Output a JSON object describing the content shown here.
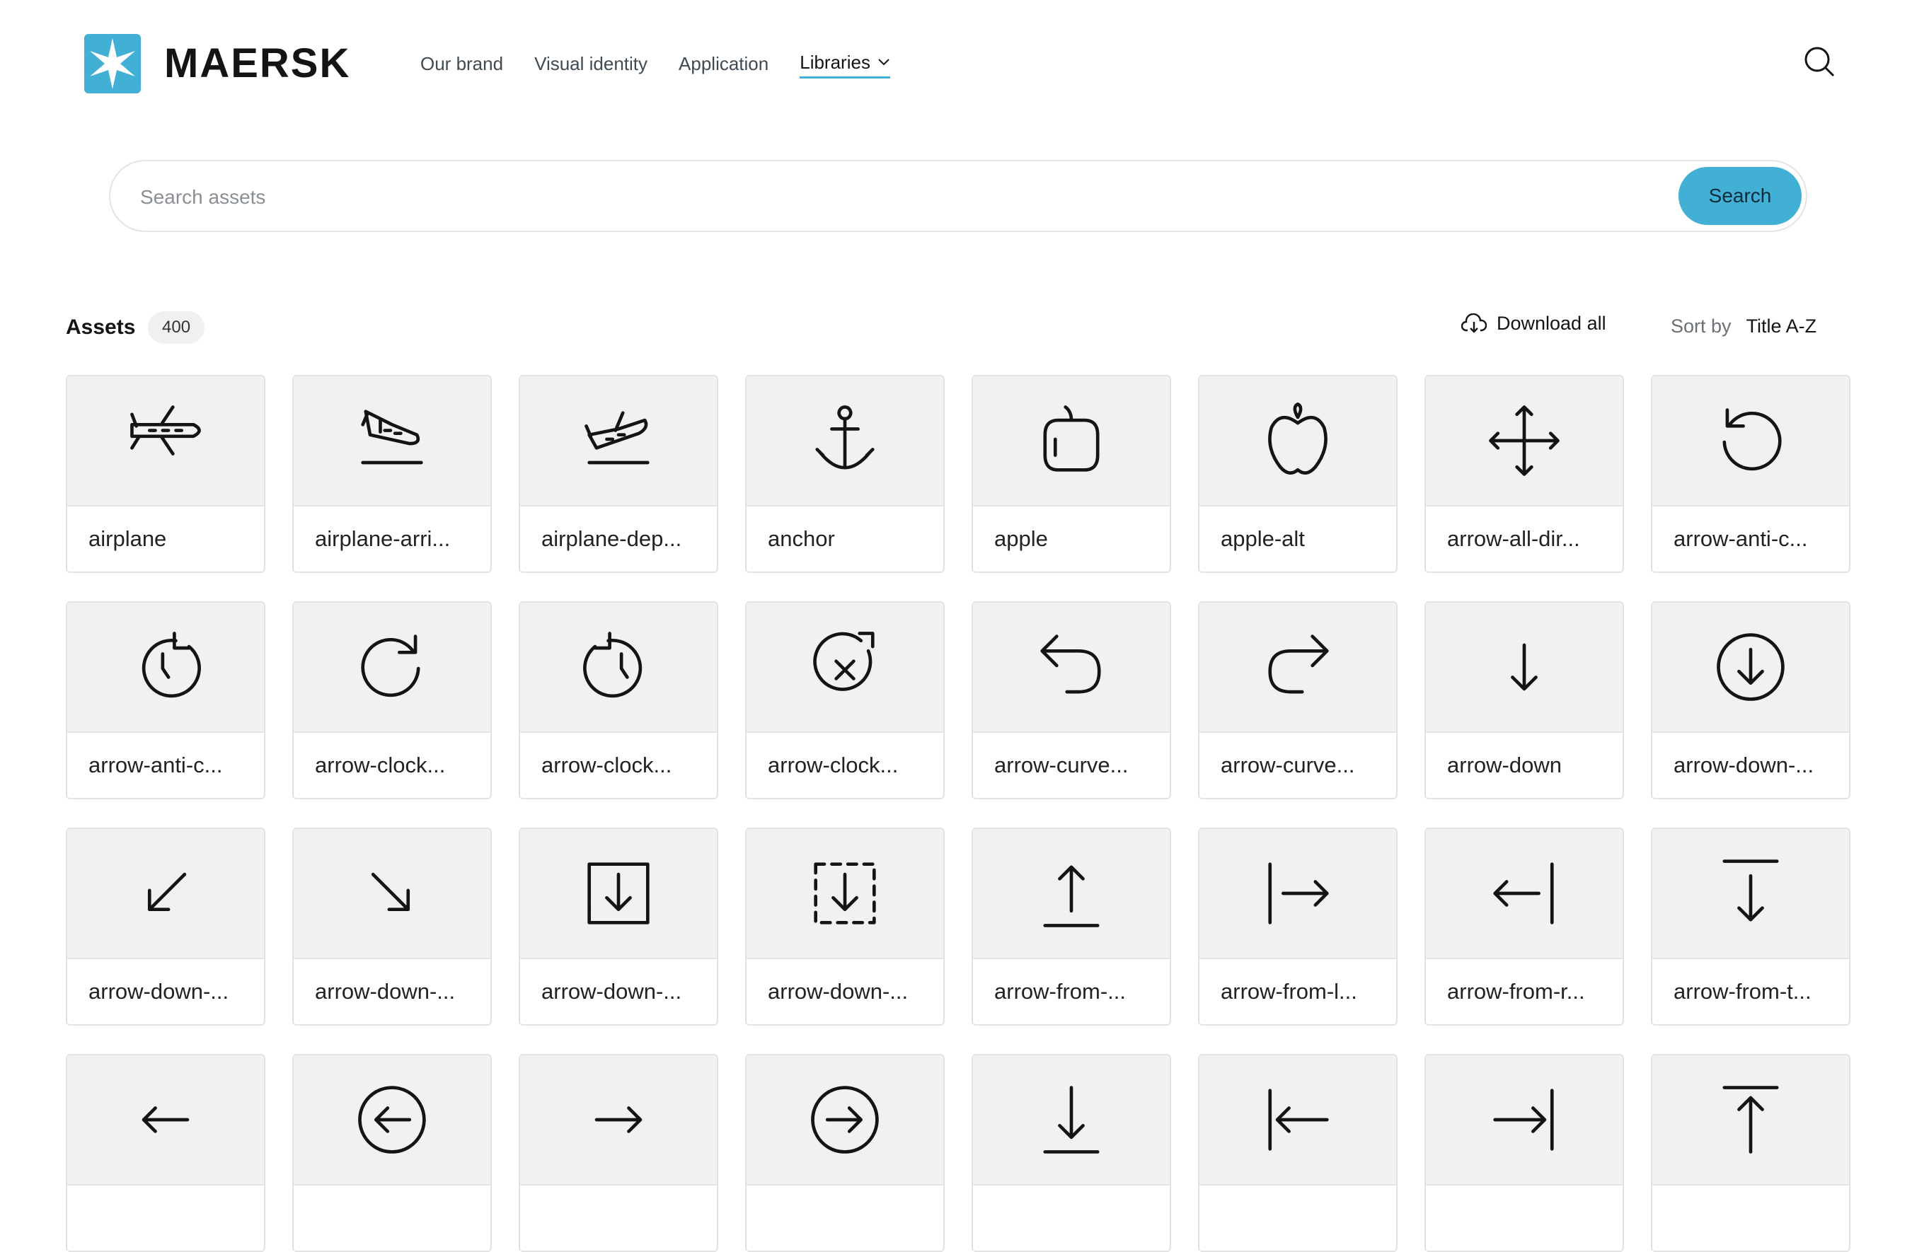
{
  "header": {
    "brand": "MAERSK",
    "nav": [
      {
        "label": "Our brand"
      },
      {
        "label": "Visual identity"
      },
      {
        "label": "Application"
      },
      {
        "label": "Libraries"
      }
    ]
  },
  "search": {
    "placeholder": "Search assets",
    "button_label": "Search"
  },
  "toolbar": {
    "title": "Assets",
    "count": "400",
    "download_label": "Download all",
    "sort_label": "Sort by",
    "sort_value": "Title A-Z"
  },
  "assets": [
    {
      "label": "airplane",
      "icon": "airplane-icon"
    },
    {
      "label": "airplane-arri...",
      "icon": "airplane-arrival-icon"
    },
    {
      "label": "airplane-dep...",
      "icon": "airplane-departure-icon"
    },
    {
      "label": "anchor",
      "icon": "anchor-icon"
    },
    {
      "label": "apple",
      "icon": "apple-icon"
    },
    {
      "label": "apple-alt",
      "icon": "apple-alt-icon"
    },
    {
      "label": "arrow-all-dir...",
      "icon": "arrow-all-directions-icon"
    },
    {
      "label": "arrow-anti-c...",
      "icon": "arrow-anticlockwise-icon"
    },
    {
      "label": "arrow-anti-c...",
      "icon": "arrow-anticlockwise-clock-icon"
    },
    {
      "label": "arrow-clock...",
      "icon": "arrow-clockwise-icon"
    },
    {
      "label": "arrow-clock...",
      "icon": "arrow-clockwise-clock-icon"
    },
    {
      "label": "arrow-clock...",
      "icon": "arrow-clockwise-times-icon"
    },
    {
      "label": "arrow-curve...",
      "icon": "arrow-curve-left-icon"
    },
    {
      "label": "arrow-curve...",
      "icon": "arrow-curve-right-icon"
    },
    {
      "label": "arrow-down",
      "icon": "arrow-down-icon"
    },
    {
      "label": "arrow-down-...",
      "icon": "arrow-down-circle-icon"
    },
    {
      "label": "arrow-down-...",
      "icon": "arrow-down-left-icon"
    },
    {
      "label": "arrow-down-...",
      "icon": "arrow-down-right-icon"
    },
    {
      "label": "arrow-down-...",
      "icon": "arrow-down-square-icon"
    },
    {
      "label": "arrow-down-...",
      "icon": "arrow-down-dashed-square-icon"
    },
    {
      "label": "arrow-from-...",
      "icon": "arrow-from-bottom-icon"
    },
    {
      "label": "arrow-from-l...",
      "icon": "arrow-from-left-icon"
    },
    {
      "label": "arrow-from-r...",
      "icon": "arrow-from-right-icon"
    },
    {
      "label": "arrow-from-t...",
      "icon": "arrow-from-top-icon"
    },
    {
      "label": "",
      "icon": "arrow-left-icon"
    },
    {
      "label": "",
      "icon": "arrow-left-circle-icon"
    },
    {
      "label": "",
      "icon": "arrow-right-icon"
    },
    {
      "label": "",
      "icon": "arrow-right-circle-icon"
    },
    {
      "label": "",
      "icon": "arrow-to-bottom-icon"
    },
    {
      "label": "",
      "icon": "arrow-to-left-icon"
    },
    {
      "label": "",
      "icon": "arrow-to-right-icon"
    },
    {
      "label": "",
      "icon": "arrow-to-top-icon"
    }
  ]
}
